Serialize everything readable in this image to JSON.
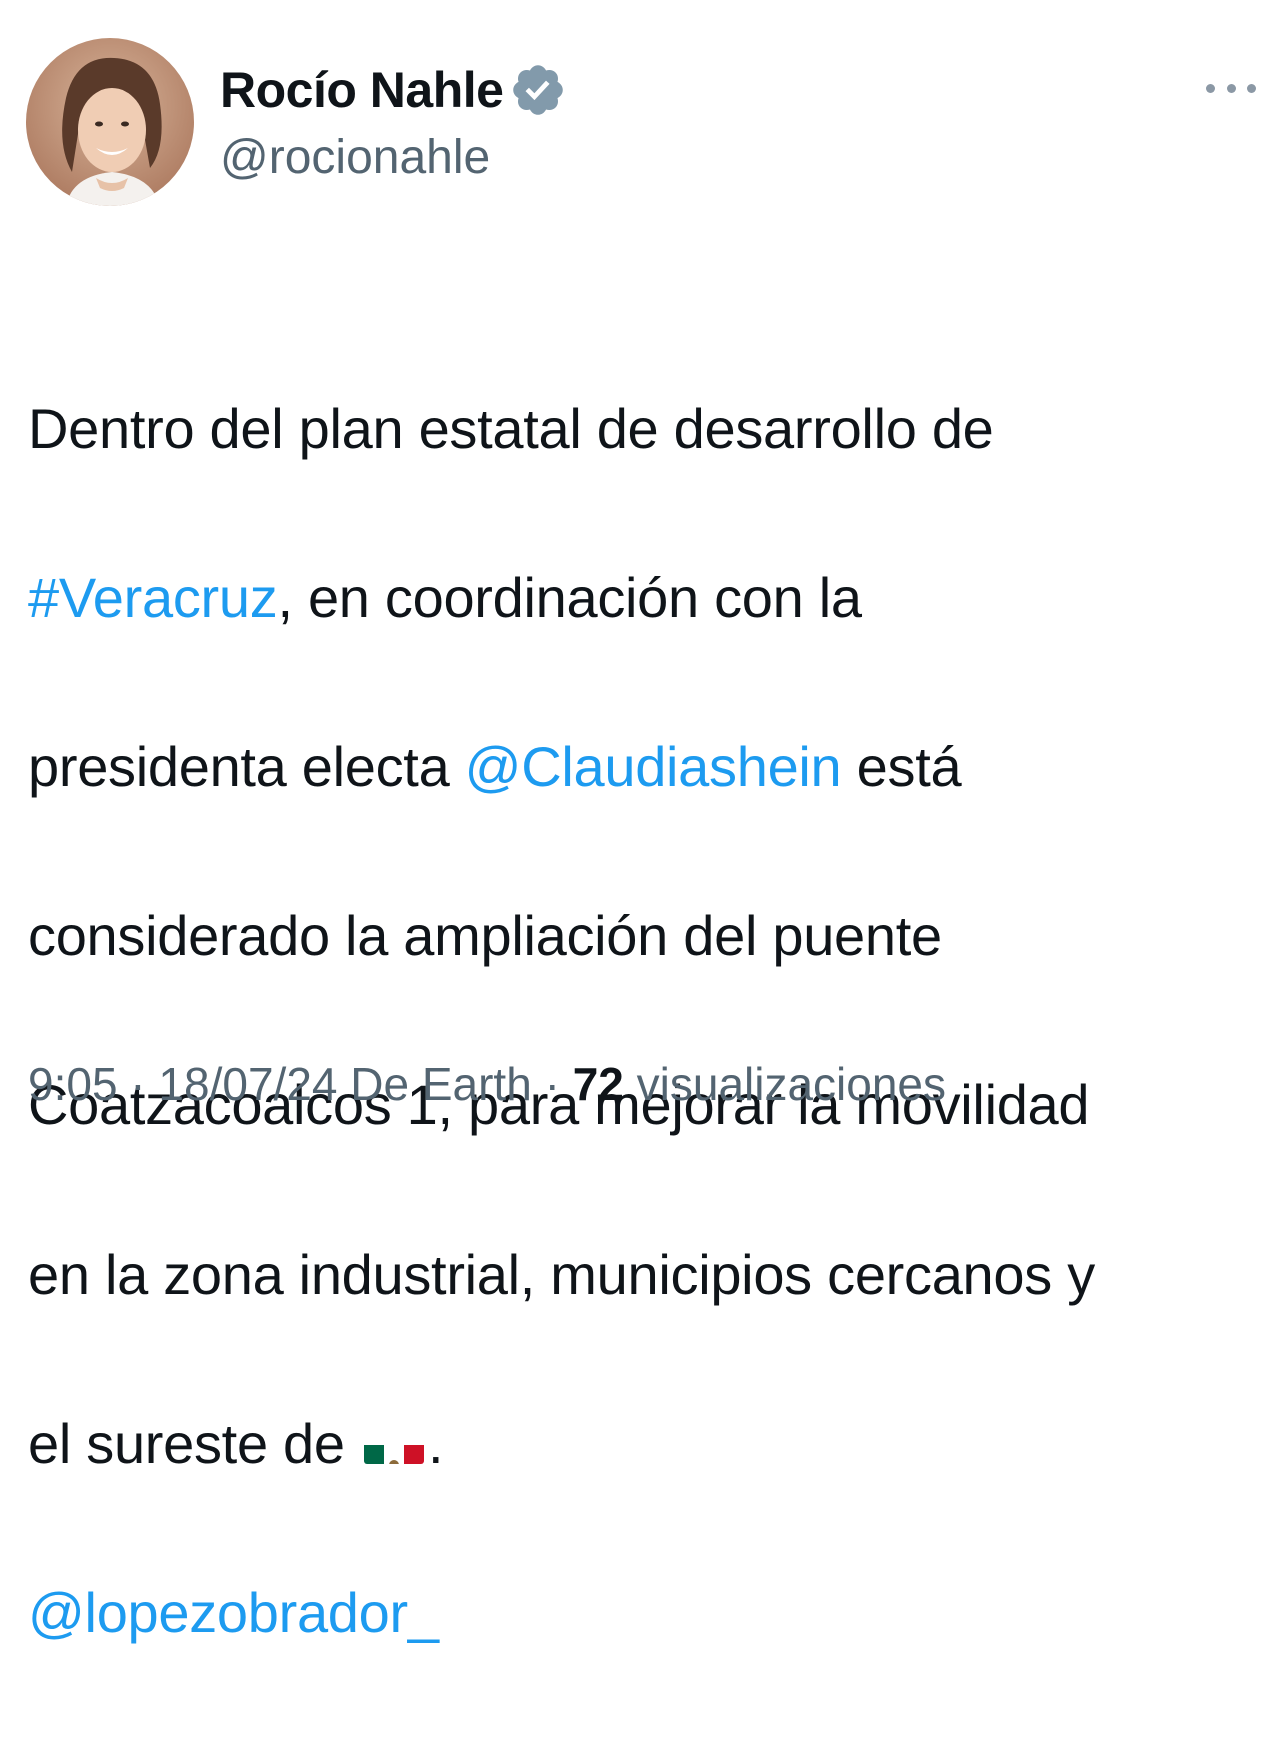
{
  "author": {
    "display_name": "Rocío Nahle",
    "handle": "@rocionahle",
    "verified_icon": "verified-badge-icon",
    "badge_color": "#829aab"
  },
  "tweet": {
    "line1": "Dentro del plan estatal de desarrollo de",
    "hashtag": "#Veracruz",
    "line2_rest": ", en coordinación con la",
    "line3_start": "presidenta electa ",
    "mention1": "@Claudiashein",
    "line3_end": " está",
    "line4": "considerado la ampliación del puente",
    "line5": "Coatzacoalcos 1, para mejorar la movilidad",
    "line6": "en la zona industrial, municipios cercanos y",
    "line7_start": "el sureste de ",
    "flag_icon": "mexico-flag-icon",
    "line7_end": ".",
    "mention2": "@lopezobrador_"
  },
  "meta": {
    "time": "9:05",
    "sep1": " · ",
    "date": "18/07/24",
    "source": " De Earth",
    "sep2": " · ",
    "views_count": "72",
    "views_label": " visualizaciones"
  },
  "colors": {
    "link": "#1d9bf0",
    "secondary_text": "#536471",
    "primary_text": "#0f1419"
  }
}
